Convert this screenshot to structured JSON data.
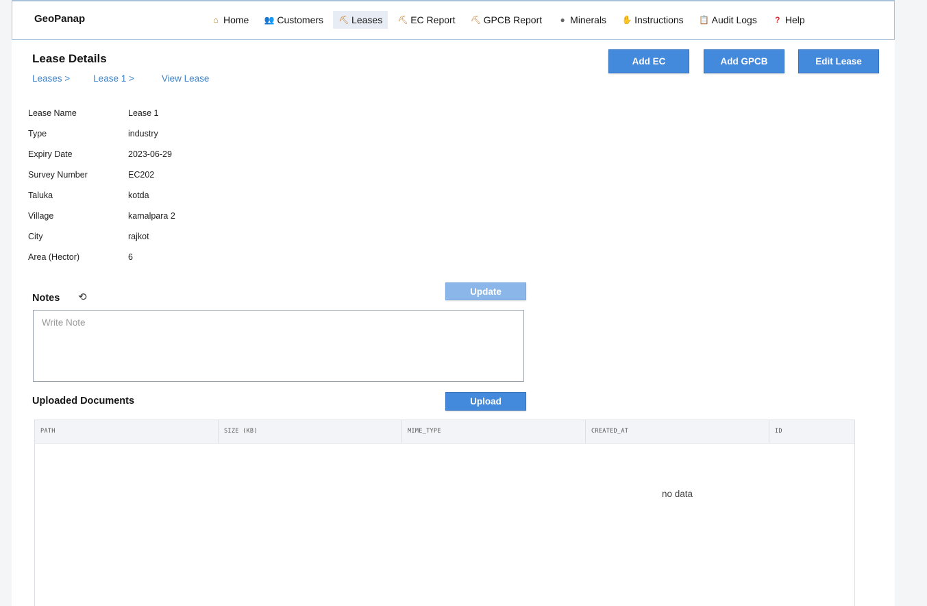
{
  "brand": "GeoPanap",
  "nav": [
    {
      "label": "Home",
      "icon": "home-icon",
      "glyph": "⌂"
    },
    {
      "label": "Customers",
      "icon": "users-icon",
      "glyph": "👥"
    },
    {
      "label": "Leases",
      "icon": "pickaxe-icon",
      "glyph": "⛏"
    },
    {
      "label": "EC Report",
      "icon": "pickaxe-icon",
      "glyph": "⛏"
    },
    {
      "label": "GPCB Report",
      "icon": "pickaxe-icon",
      "glyph": "⛏"
    },
    {
      "label": "Minerals",
      "icon": "rock-icon",
      "glyph": "●"
    },
    {
      "label": "Instructions",
      "icon": "handshake-icon",
      "glyph": "✋"
    },
    {
      "label": "Audit Logs",
      "icon": "clipboard-icon",
      "glyph": "📋"
    },
    {
      "label": "Help",
      "icon": "question-icon",
      "glyph": "?"
    }
  ],
  "active_nav": "Leases",
  "page_title": "Lease Details",
  "breadcrumb": [
    "Leases >",
    "Lease 1 >",
    "View Lease"
  ],
  "actions": {
    "add_ec": "Add EC",
    "add_gpcb": "Add GPCB",
    "edit_lease": "Edit Lease"
  },
  "details": [
    {
      "key": "Lease Name",
      "value": "Lease 1"
    },
    {
      "key": "Type",
      "value": "industry"
    },
    {
      "key": "Expiry Date",
      "value": "2023-06-29"
    },
    {
      "key": "Survey Number",
      "value": "EC202"
    },
    {
      "key": "Taluka",
      "value": "kotda"
    },
    {
      "key": "Village",
      "value": "kamalpara 2"
    },
    {
      "key": "City",
      "value": "rajkot"
    },
    {
      "key": "Area (Hector)",
      "value": "6"
    }
  ],
  "notes": {
    "title": "Notes",
    "placeholder": "Write Note",
    "update_label": "Update",
    "history_icon": "history-icon",
    "history_glyph": "⟲"
  },
  "documents": {
    "title": "Uploaded Documents",
    "upload_label": "Upload",
    "columns": [
      "PATH",
      "SIZE (KB)",
      "MIME_TYPE",
      "CREATED_AT",
      "ID"
    ],
    "empty_text": "no data"
  },
  "colors": {
    "primary": "#4389dc",
    "primary_disabled": "#8ab6ea",
    "link": "#3b82c8"
  }
}
